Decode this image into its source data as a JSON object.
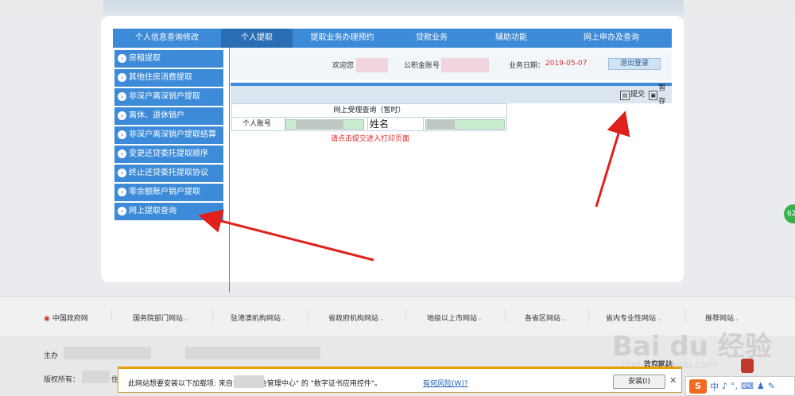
{
  "topnav": [
    {
      "label": "个人信息查询修改",
      "active": false
    },
    {
      "label": "个人提取",
      "active": true
    },
    {
      "label": "提取业务办理预约",
      "active": false
    },
    {
      "label": "贷款业务",
      "active": false
    },
    {
      "label": "辅助功能",
      "active": false
    },
    {
      "label": "网上申办及查询",
      "active": false
    }
  ],
  "sidebar": [
    {
      "label": "房租提取"
    },
    {
      "label": "其他住房消费提取"
    },
    {
      "label": "非深户离深销户提取"
    },
    {
      "label": "离休、退休销户"
    },
    {
      "label": "非深户离深销户提取结算"
    },
    {
      "label": "变更还贷委托提取顺序"
    },
    {
      "label": "终止还贷委托提取协议"
    },
    {
      "label": "零余额账户销户提取"
    },
    {
      "label": "网上提取查询"
    }
  ],
  "welcome": {
    "greeting": "欢迎您",
    "account_label": "公积金账号",
    "date_label": "业务日期：",
    "date_value": "2019-05-07",
    "logout": "退出登录"
  },
  "toolbar": {
    "submit": "提交",
    "save": "暂存"
  },
  "form": {
    "title": "网上受理查询（暂时）",
    "account_label": "个人账号",
    "name_label": "姓名",
    "tip": "请点击提交进入打印页面"
  },
  "footer_links": [
    {
      "label": "中国政府网",
      "caret": ""
    },
    {
      "label": "国务院部门网站",
      "caret": "⌄"
    },
    {
      "label": "驻港澳机构网站",
      "caret": "⌄"
    },
    {
      "label": "省政府机构网站",
      "caret": "⌄"
    },
    {
      "label": "地级以上市网站",
      "caret": "⌄"
    },
    {
      "label": "各省区网站",
      "caret": "⌄"
    },
    {
      "label": "省内专业性网站",
      "caret": "⌄"
    },
    {
      "label": "推荐网站",
      "caret": "⌄"
    }
  ],
  "footer_info": {
    "host_label": "主办",
    "copyright_label": "版权所有：",
    "copyright_tail": "住",
    "gov_site": "政府网站"
  },
  "infobar": {
    "message": "此网站想要安装以下加载项: 来自\"                  房公积金管理中心\" 的 \"数字证书应用控件\"。",
    "risk_link": "有何风险(W)?",
    "install": "安装(I)",
    "close": "✕"
  },
  "side_badge": "62",
  "watermark": {
    "brand": "Bai du 经验",
    "url": "jingyan.baidu.com"
  },
  "ime": {
    "logo": "S",
    "items": [
      "中",
      "♪",
      "°,",
      "⌨",
      "♟",
      "✎"
    ]
  },
  "colors": {
    "nav_blue": "#3d8bd8",
    "nav_active": "#2a6fb6",
    "arrow_red": "#e0201b",
    "date_red": "#e03030"
  }
}
